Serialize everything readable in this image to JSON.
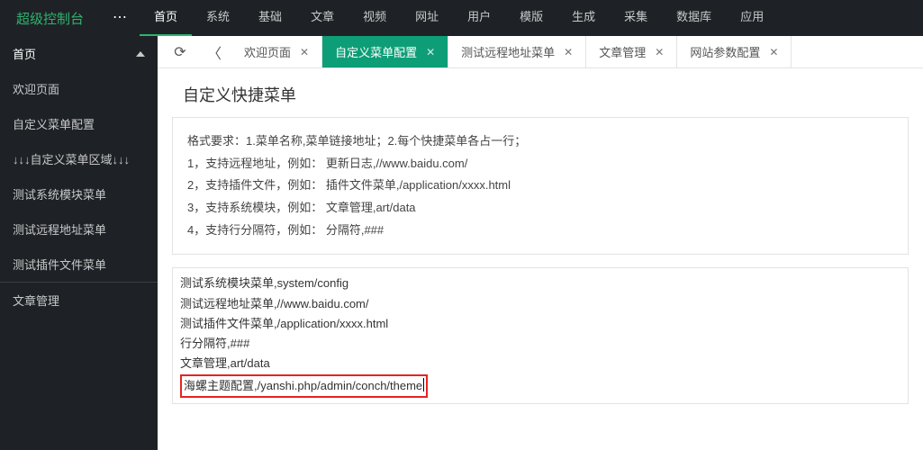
{
  "logo": "超级控制台",
  "topnav": [
    "首页",
    "系统",
    "基础",
    "文章",
    "视频",
    "网址",
    "用户",
    "模版",
    "生成",
    "采集",
    "数据库",
    "应用"
  ],
  "topnav_active": 0,
  "sidebar": {
    "header": "首页",
    "items": [
      "欢迎页面",
      "自定义菜单配置",
      "↓↓↓自定义菜单区域↓↓↓",
      "测试系统模块菜单",
      "测试远程地址菜单",
      "测试插件文件菜单"
    ],
    "bottom": "文章管理"
  },
  "tabs": [
    {
      "label": "欢迎页面",
      "closable": true,
      "active": false
    },
    {
      "label": "自定义菜单配置",
      "closable": true,
      "active": true
    },
    {
      "label": "测试远程地址菜单",
      "closable": true,
      "active": false
    },
    {
      "label": "文章管理",
      "closable": true,
      "active": false
    },
    {
      "label": "网站参数配置",
      "closable": true,
      "active": false
    }
  ],
  "page_title": "自定义快捷菜单",
  "help": {
    "l0": "格式要求：1.菜单名称,菜单链接地址；2.每个快捷菜单各占一行；",
    "l1": "1，支持远程地址，例如： 更新日志,//www.baidu.com/",
    "l2": "2，支持插件文件，例如： 插件文件菜单,/application/xxxx.html",
    "l3": "3，支持系统模块，例如： 文章管理,art/data",
    "l4": "4，支持行分隔符，例如： 分隔符,###"
  },
  "editor": {
    "lines": [
      "测试系统模块菜单,system/config",
      "测试远程地址菜单,//www.baidu.com/",
      "测试插件文件菜单,/application/xxxx.html",
      "行分隔符,###",
      "文章管理,art/data"
    ],
    "highlight": "海螺主题配置,/yanshi.php/admin/conch/theme"
  }
}
